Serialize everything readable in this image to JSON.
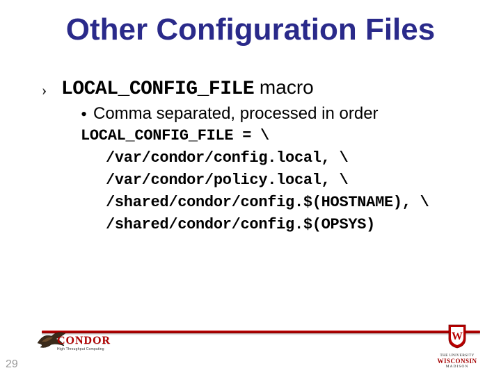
{
  "title": "Other Configuration Files",
  "bullet": {
    "macro_name": "LOCAL_CONFIG_FILE",
    "macro_suffix": " macro",
    "sub": "Comma separated, processed in order"
  },
  "code": {
    "line1": "LOCAL_CONFIG_FILE = \\",
    "lines": [
      "/var/condor/config.local, \\",
      "/var/condor/policy.local, \\",
      "/shared/condor/config.$(HOSTNAME), \\",
      "/shared/condor/config.$(OPSYS)"
    ]
  },
  "footer": {
    "page_number": "29",
    "condor": {
      "word": "CONDOR",
      "sub": "High Throughput Computing"
    },
    "wisconsin": {
      "top": "THE UNIVERSITY",
      "main": "WISCONSIN",
      "bottom": "MADISON"
    }
  }
}
